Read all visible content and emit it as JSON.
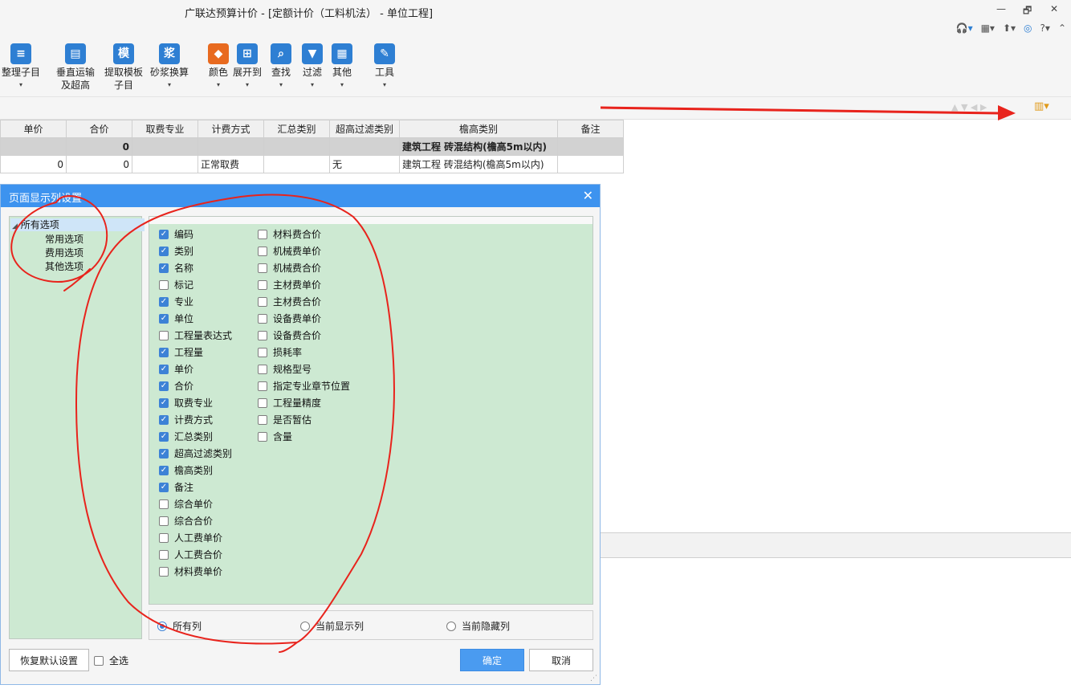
{
  "window": {
    "title": "广联达预算计价 - [定额计价（工料机法） - 单位工程]",
    "restore_glyph": "🗗",
    "close_glyph": "✕"
  },
  "title_icons": [
    "headset-icon",
    "grid-icon",
    "upload-icon",
    "service-icon",
    "help-icon",
    "collapse-icon"
  ],
  "ribbon": {
    "items": [
      {
        "label": "整理子目",
        "label2": "",
        "icon": "organize-icon",
        "color": "#2e7fd3",
        "glyph": "≡"
      },
      {
        "label": "垂直运输",
        "label2": "及超高",
        "icon": "vertical-transport-icon",
        "color": "#2e7fd3",
        "glyph": "▤"
      },
      {
        "label": "提取模板",
        "label2": "子目",
        "icon": "template-icon",
        "color": "#2e7fd3",
        "glyph": "模"
      },
      {
        "label": "砂浆换算",
        "label2": "",
        "icon": "mortar-icon",
        "color": "#2e7fd3",
        "glyph": "浆"
      },
      {
        "label": "颜色",
        "label2": "",
        "icon": "color-icon",
        "color": "#e86a1f",
        "glyph": "◆"
      },
      {
        "label": "展开到",
        "label2": "",
        "icon": "expand-icon",
        "color": "#2e7fd3",
        "glyph": "⊞"
      },
      {
        "label": "查找",
        "label2": "",
        "icon": "find-icon",
        "color": "#2e7fd3",
        "glyph": "⌕"
      },
      {
        "label": "过滤",
        "label2": "",
        "icon": "filter-icon",
        "color": "#2e7fd3",
        "glyph": "▼"
      },
      {
        "label": "其他",
        "label2": "",
        "icon": "other-icon",
        "color": "#2e7fd3",
        "glyph": "▦"
      },
      {
        "label": "工具",
        "label2": "",
        "icon": "tools-icon",
        "color": "#2e7fd3",
        "glyph": "✎"
      }
    ]
  },
  "table": {
    "headers": [
      "单价",
      "合价",
      "取费专业",
      "计费方式",
      "汇总类别",
      "超高过滤类别",
      "檐高类别",
      "备注"
    ],
    "group_row": [
      "",
      "0",
      "",
      "",
      "",
      "",
      "建筑工程 砖混结构(檐高5m以内)",
      ""
    ],
    "data_row": [
      "0",
      "0",
      "",
      "正常取费",
      "",
      "无",
      "建筑工程 砖混结构(檐高5m以内)",
      ""
    ]
  },
  "dialog": {
    "title": "页面显示列设置",
    "tree": {
      "root": "所有选项",
      "children": [
        "常用选项",
        "费用选项",
        "其他选项"
      ]
    },
    "columns_left": [
      {
        "label": "编码",
        "checked": true
      },
      {
        "label": "类别",
        "checked": true
      },
      {
        "label": "名称",
        "checked": true
      },
      {
        "label": "标记",
        "checked": false
      },
      {
        "label": "专业",
        "checked": true
      },
      {
        "label": "单位",
        "checked": true
      },
      {
        "label": "工程量表达式",
        "checked": false
      },
      {
        "label": "工程量",
        "checked": true
      },
      {
        "label": "单价",
        "checked": true
      },
      {
        "label": "合价",
        "checked": true
      },
      {
        "label": "取费专业",
        "checked": true
      },
      {
        "label": "计费方式",
        "checked": true
      },
      {
        "label": "汇总类别",
        "checked": true
      },
      {
        "label": "超高过滤类别",
        "checked": true
      },
      {
        "label": "檐高类别",
        "checked": true
      },
      {
        "label": "备注",
        "checked": true
      },
      {
        "label": "综合单价",
        "checked": false
      },
      {
        "label": "综合合价",
        "checked": false
      },
      {
        "label": "人工费单价",
        "checked": false
      },
      {
        "label": "人工费合价",
        "checked": false
      },
      {
        "label": "材料费单价",
        "checked": false
      }
    ],
    "columns_right": [
      {
        "label": "材料费合价",
        "checked": false
      },
      {
        "label": "机械费单价",
        "checked": false
      },
      {
        "label": "机械费合价",
        "checked": false
      },
      {
        "label": "主材费单价",
        "checked": false
      },
      {
        "label": "主材费合价",
        "checked": false
      },
      {
        "label": "设备费单价",
        "checked": false
      },
      {
        "label": "设备费合价",
        "checked": false
      },
      {
        "label": "损耗率",
        "checked": false
      },
      {
        "label": "规格型号",
        "checked": false
      },
      {
        "label": "指定专业章节位置",
        "checked": false
      },
      {
        "label": "工程量精度",
        "checked": false
      },
      {
        "label": "是否暂估",
        "checked": false
      },
      {
        "label": "含量",
        "checked": false
      }
    ],
    "radios": [
      {
        "label": "所有列",
        "selected": true
      },
      {
        "label": "当前显示列",
        "selected": false
      },
      {
        "label": "当前隐藏列",
        "selected": false
      }
    ],
    "restore_label": "恢复默认设置",
    "select_all_label": "全选",
    "ok_label": "确定",
    "cancel_label": "取消"
  },
  "annotation_color": "#e8231c"
}
